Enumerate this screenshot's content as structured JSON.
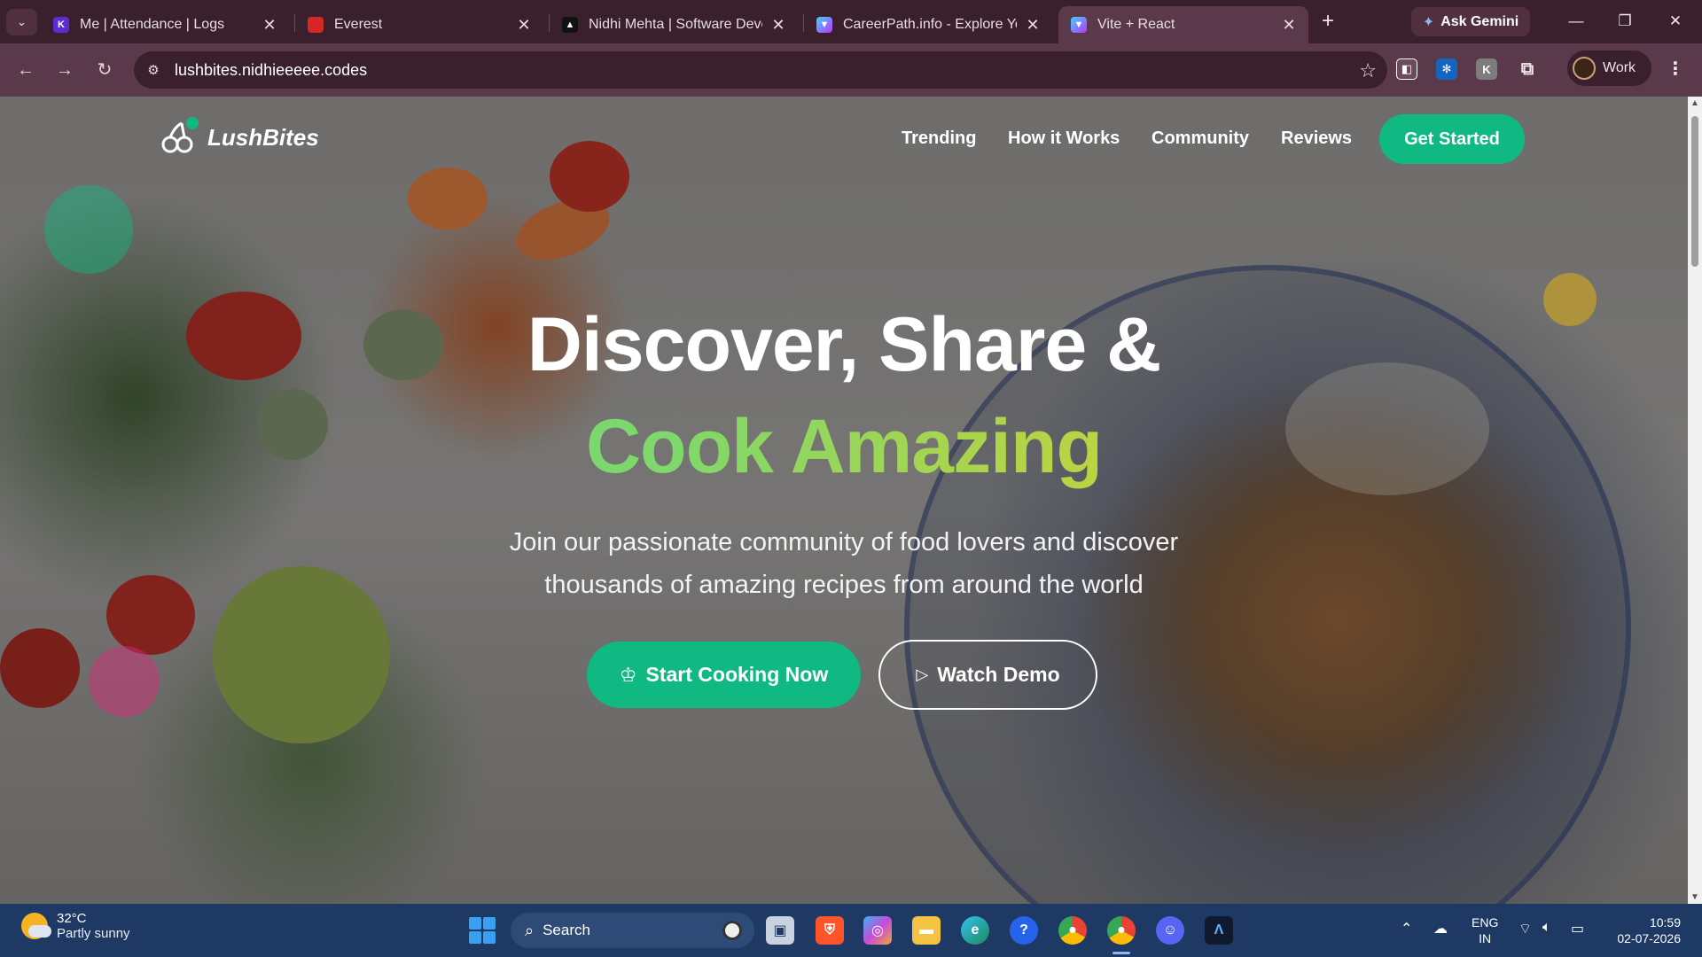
{
  "browser": {
    "tabs": [
      {
        "title": "Me | Attendance | Logs",
        "favicon": "keka-icon",
        "fav_color": "#5b2bd6",
        "fav_text": "K"
      },
      {
        "title": "Everest",
        "favicon": "everest-icon",
        "fav_color": "#d62626",
        "fav_text": ""
      },
      {
        "title": "Nidhi Mehta | Software Devel",
        "favicon": "triangle-icon",
        "fav_color": "#111111",
        "fav_text": "▲"
      },
      {
        "title": "CareerPath.info - Explore Your",
        "favicon": "vite-icon",
        "fav_color": "#8a5cf6",
        "fav_text": "▼"
      },
      {
        "title": "Vite + React",
        "favicon": "vite-icon",
        "fav_color": "#8a5cf6",
        "fav_text": "▼"
      }
    ],
    "new_tab_label": "+",
    "gemini_label": "Ask Gemini",
    "url": "lushbites.nidhieeeee.codes",
    "profile_label": "Work"
  },
  "site": {
    "brand": "LushBites",
    "nav": [
      "Trending",
      "How it Works",
      "Community",
      "Reviews"
    ],
    "cta_nav": "Get Started",
    "hero_line1": "Discover, Share &",
    "hero_line2": "Cook Amazing",
    "subtitle_line1": "Join our passionate community of food lovers and discover",
    "subtitle_line2": "thousands of amazing recipes from around the world",
    "primary_button": "Start Cooking Now",
    "secondary_button": "Watch Demo",
    "accent_color": "#10b981"
  },
  "taskbar": {
    "weather_temp": "32°C",
    "weather_desc": "Partly sunny",
    "search_label": "Search",
    "lang_line1": "ENG",
    "lang_line2": "IN",
    "time": "10:59",
    "date": "02-07-2026"
  }
}
